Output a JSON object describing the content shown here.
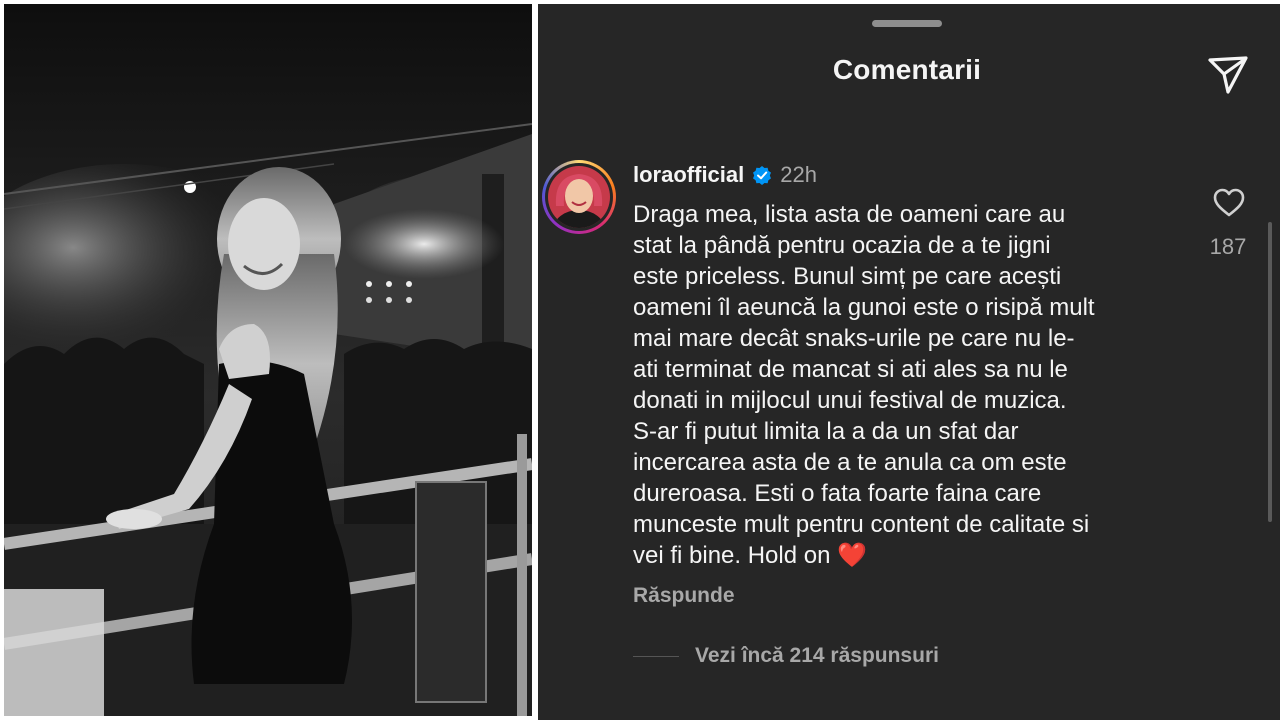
{
  "header": {
    "title": "Comentarii",
    "share_icon": "send-icon"
  },
  "comment": {
    "username": "loraofficial",
    "verified": true,
    "time": "22h",
    "text": "Draga mea, lista asta de oameni care au\nstat la pândă pentru ocazia de a te jigni\neste priceless. Bunul simț pe care acești\noameni îl aeuncă la gunoi este o risipă mult\nmai mare decât snaks-urile pe care nu le-\nati terminat de mancat si ati ales sa nu le\ndonati in mijlocul unui festival de muzica.\nS-ar fi putut limita la a da un sfat dar\nincercarea asta de a te anula ca om este\ndureroasa. Esti o fata foarte faina care\nmunceste mult pentru content de calitate si\nvei fi bine. Hold on ",
    "emoji": "❤️",
    "likes": "187",
    "reply_label": "Răspunde",
    "view_replies": "Vezi încă 214 răspunsuri"
  },
  "colors": {
    "panel_bg": "#262626",
    "text": "#f5f5f5",
    "muted": "#a8a8a8",
    "verified": "#0095f6"
  }
}
